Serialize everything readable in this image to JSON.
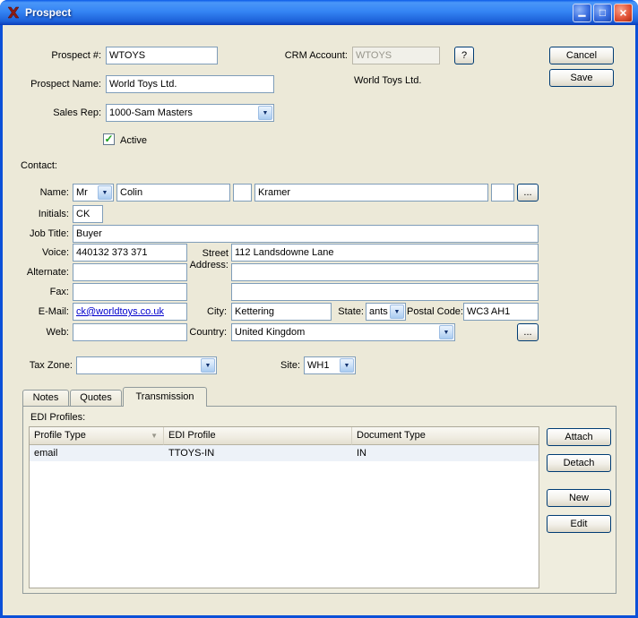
{
  "window": {
    "title": "Prospect"
  },
  "icons": {
    "minimize": "▁",
    "maximize": "□",
    "close": "×",
    "dropdown_arrow": "▼",
    "sort_desc": "▼",
    "check": "✓"
  },
  "header": {
    "prospect_number_label": "Prospect #:",
    "prospect_number_value": "WTOYS",
    "crm_account_label": "CRM Account:",
    "crm_account_value": "WTOYS",
    "crm_help_label": "?",
    "crm_account_name": "World Toys Ltd.",
    "cancel_label": "Cancel",
    "save_label": "Save",
    "prospect_name_label": "Prospect Name:",
    "prospect_name_value": "World Toys Ltd.",
    "sales_rep_label": "Sales Rep:",
    "sales_rep_value": "1000-Sam Masters",
    "active_label": "Active"
  },
  "contact": {
    "section_label": "Contact:",
    "name_label": "Name:",
    "honorific_value": "Mr",
    "first_name_value": "Colin",
    "middle_value": "",
    "last_name_value": "Kramer",
    "suffix_value": "",
    "more_label": "...",
    "initials_label": "Initials:",
    "initials_value": "CK",
    "job_title_label": "Job Title:",
    "job_title_value": "Buyer",
    "voice_label": "Voice:",
    "voice_value": "440132 373 371",
    "alternate_label": "Alternate:",
    "alternate_value": "",
    "fax_label": "Fax:",
    "fax_value": "",
    "email_label": "E-Mail:",
    "email_value": "ck@worldtoys.co.uk",
    "web_label": "Web:",
    "web_value": "",
    "street_label": "Street Address:",
    "address1_value": "112 Landsdowne Lane",
    "address2_value": "",
    "address3_value": "",
    "city_label": "City:",
    "city_value": "Kettering",
    "state_label": "State:",
    "state_value": "ants",
    "postal_label": "Postal Code:",
    "postal_value": "WC3 AH1",
    "country_label": "Country:",
    "country_value": "United Kingdom",
    "country_more_label": "..."
  },
  "footer": {
    "tax_zone_label": "Tax Zone:",
    "tax_zone_value": "",
    "site_label": "Site:",
    "site_value": "WH1"
  },
  "tabs": [
    {
      "label": "Notes"
    },
    {
      "label": "Quotes"
    },
    {
      "label": "Transmission"
    }
  ],
  "transmission": {
    "edi_profiles_label": "EDI Profiles:",
    "table": {
      "columns": [
        "Profile Type",
        "EDI Profile",
        "Document Type"
      ],
      "rows": [
        {
          "profile_type": "email",
          "edi_profile": "TTOYS-IN",
          "document_type": "IN"
        }
      ]
    },
    "buttons": [
      "Attach",
      "Detach",
      "New",
      "Edit"
    ]
  }
}
